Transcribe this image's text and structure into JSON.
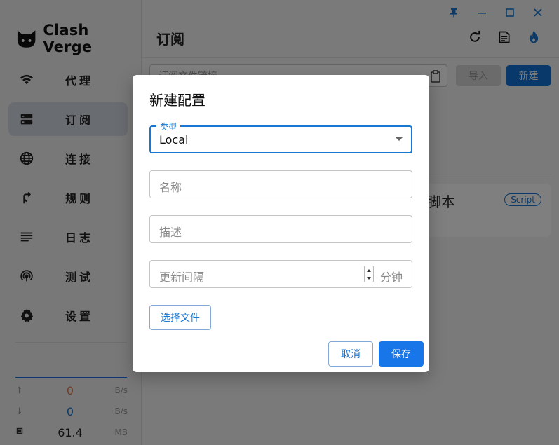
{
  "app": {
    "logo_text": "Clash Verge"
  },
  "sidebar": {
    "items": [
      {
        "label": "代理",
        "icon": "wifi-icon"
      },
      {
        "label": "订阅",
        "icon": "storage-icon",
        "active": true
      },
      {
        "label": "连接",
        "icon": "globe-icon"
      },
      {
        "label": "规则",
        "icon": "fork-icon"
      },
      {
        "label": "日志",
        "icon": "lines-icon"
      },
      {
        "label": "测试",
        "icon": "radar-icon"
      },
      {
        "label": "设置",
        "icon": "gear-icon"
      }
    ],
    "traffic": {
      "upload": {
        "value": "0",
        "unit": "B/s",
        "color": "#e07b4f"
      },
      "download": {
        "value": "0",
        "unit": "B/s",
        "color": "#1976d2"
      },
      "memory": {
        "value": "61.4",
        "unit": "MB"
      }
    }
  },
  "header": {
    "title": "订阅"
  },
  "toolbar": {
    "url_placeholder": "订阅文件链接",
    "import_label": "导入",
    "new_label": "新建"
  },
  "card": {
    "title_fragment": "脚本",
    "badge": "Script"
  },
  "dialog": {
    "title": "新建配置",
    "type_label": "类型",
    "type_value": "Local",
    "name_placeholder": "名称",
    "desc_placeholder": "描述",
    "interval_placeholder": "更新间隔",
    "interval_unit": "分钟",
    "file_button": "选择文件",
    "cancel_button": "取消",
    "save_button": "保存"
  },
  "colors": {
    "accent": "#1976d2",
    "primary_button": "#1976e8"
  }
}
